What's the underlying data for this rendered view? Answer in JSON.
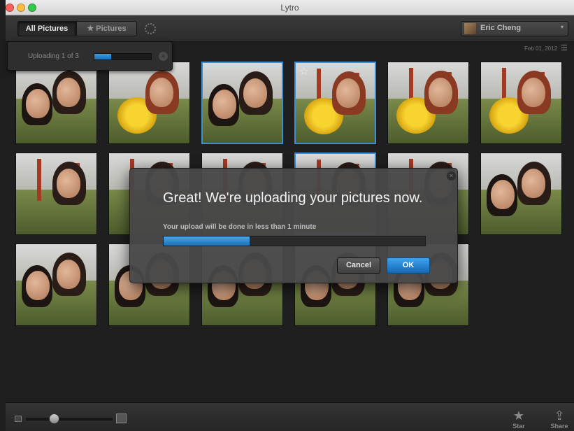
{
  "window": {
    "title": "Lytro"
  },
  "toolbar": {
    "all_pictures_label": "All Pictures",
    "starred_label": "★ Pictures",
    "user_name": "Eric Cheng",
    "user_menu_arrow": "▾"
  },
  "date_header": {
    "date": "Feb 01, 2012",
    "menu_glyph": "☰"
  },
  "upload_popover": {
    "status": "Uploading 1 of 3",
    "progress": 0.3,
    "cancel_glyph": "×"
  },
  "upload_dialog": {
    "title": "Great! We're uploading your pictures now.",
    "message": "Your upload will be done in less than 1 minute",
    "progress": 0.33,
    "cancel_label": "Cancel",
    "ok_label": "OK",
    "close_glyph": "×"
  },
  "thumbnails": [
    {
      "scene": "selfie-group",
      "selected": false
    },
    {
      "scene": "flower-girl",
      "selected": false
    },
    {
      "scene": "selfie-couple",
      "selected": true
    },
    {
      "scene": "flower-bridge",
      "selected": true,
      "starred": false
    },
    {
      "scene": "flower-bridge",
      "selected": false
    },
    {
      "scene": "flower-bridge",
      "selected": false
    },
    {
      "scene": "bridge-people",
      "selected": false
    },
    {
      "scene": "bridge-people",
      "selected": false
    },
    {
      "scene": "bridge-people",
      "selected": false
    },
    {
      "scene": "bridge-people",
      "selected": true
    },
    {
      "scene": "bridge-people",
      "selected": false
    },
    {
      "scene": "selfie-couple",
      "selected": false
    },
    {
      "scene": "selfie-couple",
      "selected": false
    },
    {
      "scene": "selfie-couple",
      "selected": false
    },
    {
      "scene": "selfie-couple",
      "selected": false
    },
    {
      "scene": "selfie-couple",
      "selected": false
    },
    {
      "scene": "selfie-couple",
      "selected": false
    }
  ],
  "bottom_bar": {
    "star_label": "Star",
    "star_glyph": "★",
    "share_label": "Share",
    "share_glyph": "⇪",
    "zoom_level": 0.3
  },
  "colors": {
    "accent": "#3d8fd6",
    "progress": "#2a86cf"
  }
}
